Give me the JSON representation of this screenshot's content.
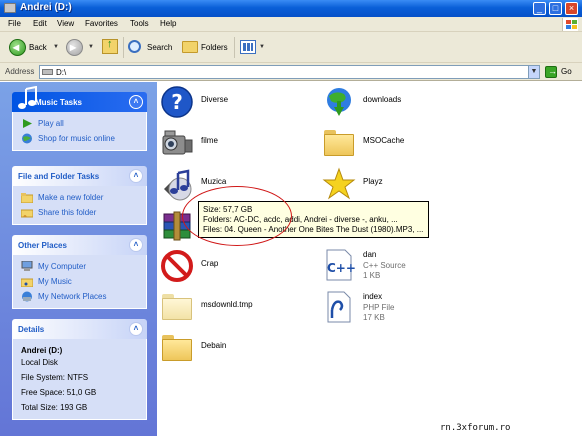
{
  "window": {
    "title": "Andrei (D:)"
  },
  "menu": [
    "File",
    "Edit",
    "View",
    "Favorites",
    "Tools",
    "Help"
  ],
  "toolbar": {
    "back_label": "Back",
    "search_label": "Search",
    "folders_label": "Folders"
  },
  "address": {
    "label": "Address",
    "value": "D:\\",
    "go_label": "Go"
  },
  "panels": {
    "music_tasks": {
      "title": "Music Tasks",
      "items": [
        "Play all",
        "Shop for music online"
      ]
    },
    "file_folder_tasks": {
      "title": "File and Folder Tasks",
      "items": [
        "Make a new folder",
        "Share this folder"
      ]
    },
    "other_places": {
      "title": "Other Places",
      "items": [
        "My Computer",
        "My Music",
        "My Network Places"
      ]
    },
    "details": {
      "title": "Details",
      "name": "Andrei (D:)",
      "type": "Local Disk",
      "file_system": "File System: NTFS",
      "free_space": "Free Space: 51,0 GB",
      "total_size": "Total Size: 193 GB"
    }
  },
  "files": [
    {
      "name": "Diverse",
      "icon": "help-icon"
    },
    {
      "name": "downloads",
      "icon": "globe-download-icon"
    },
    {
      "name": "filme",
      "icon": "camcorder-icon"
    },
    {
      "name": "MSOCache",
      "icon": "folder-icon"
    },
    {
      "name": "Muzica",
      "icon": "music-folder-icon"
    },
    {
      "name": "Playz",
      "icon": "star-folder-icon"
    },
    {
      "name": "",
      "icon": "winrar-icon"
    },
    {
      "name": "dan",
      "icon": "cpp-file-icon",
      "type": "C++ Source",
      "size": "1 KB"
    },
    {
      "name": "Crap",
      "icon": "forbidden-icon"
    },
    {
      "name": "index",
      "icon": "php-file-icon",
      "type": "PHP File",
      "size": "17 KB"
    },
    {
      "name": "msdownld.tmp",
      "icon": "folder-icon"
    },
    {
      "name": "Debain",
      "icon": "folder-icon"
    }
  ],
  "tooltip": {
    "size": "Size: 57,7 GB",
    "folders": "Folders: AC-DC, acdc, addi, Andrei - diverse -, anku, ...",
    "files": "Files: 04. Queen - Another One Bites The Dust (1980).MP3, ..."
  },
  "watermark": "rn.3xforum.ro",
  "colors": {
    "titlebar": "#0a5fd8",
    "taskpane": "#6375d6",
    "link": "#215dc6",
    "tooltip_bg": "#ffffe1",
    "annotation": "#d01818"
  }
}
